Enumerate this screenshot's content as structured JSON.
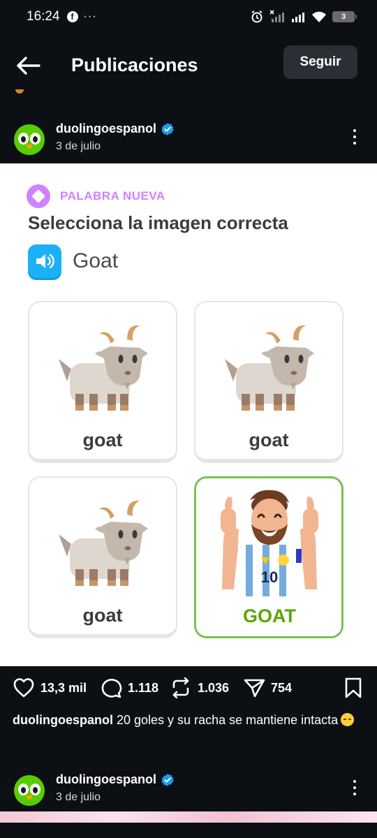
{
  "status_bar": {
    "time": "16:24",
    "battery": "3"
  },
  "header": {
    "title": "Publicaciones",
    "follow_label": "Seguir"
  },
  "post": {
    "username": "duolingoespanol",
    "date": "3 de julio",
    "card": {
      "tag": "PALABRA NUEVA",
      "question": "Selecciona la imagen correcta",
      "audio_word": "Goat",
      "choices": [
        {
          "label": "goat",
          "image": "goat-illustration"
        },
        {
          "label": "goat",
          "image": "goat-illustration"
        },
        {
          "label": "goat",
          "image": "goat-illustration"
        },
        {
          "label": "GOAT",
          "image": "footballer-illustration",
          "selected": true,
          "jersey_number": "10"
        }
      ]
    },
    "actions": {
      "likes": "13,3 mil",
      "comments": "1.118",
      "reposts": "1.036",
      "shares": "754"
    },
    "caption_user": "duolingoespanol",
    "caption_text": " 20 goles y su racha se mantiene intacta"
  },
  "next_post": {
    "username": "duolingoespanol",
    "date": "3 de julio"
  },
  "colors": {
    "background": "#0c0f14",
    "duo_green": "#58cc02",
    "tag_purple": "#ce82ff",
    "speaker_blue": "#1cb0f6",
    "selected_green": "#58a700",
    "verified_blue": "#1d9bf0"
  }
}
